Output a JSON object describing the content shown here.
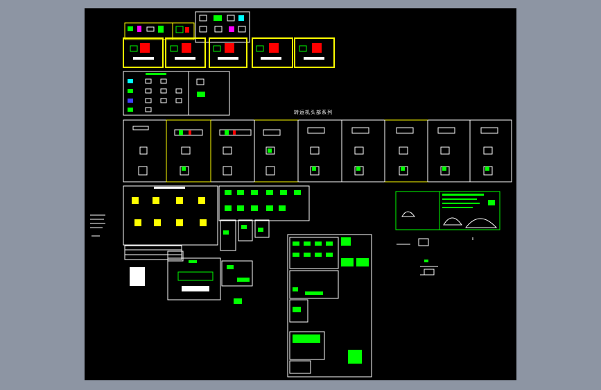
{
  "colors": {
    "background_outer": "#8d95a3",
    "drawing_canvas": "#000000",
    "frame_white": "#ffffff",
    "frame_yellow": "#ffff00",
    "frame_green": "#00ff00",
    "accent_red": "#ff0000",
    "accent_magenta": "#ff00ff",
    "accent_cyan": "#00ffff",
    "accent_blue": "#4040ff"
  },
  "title": "转运机头部系列"
}
